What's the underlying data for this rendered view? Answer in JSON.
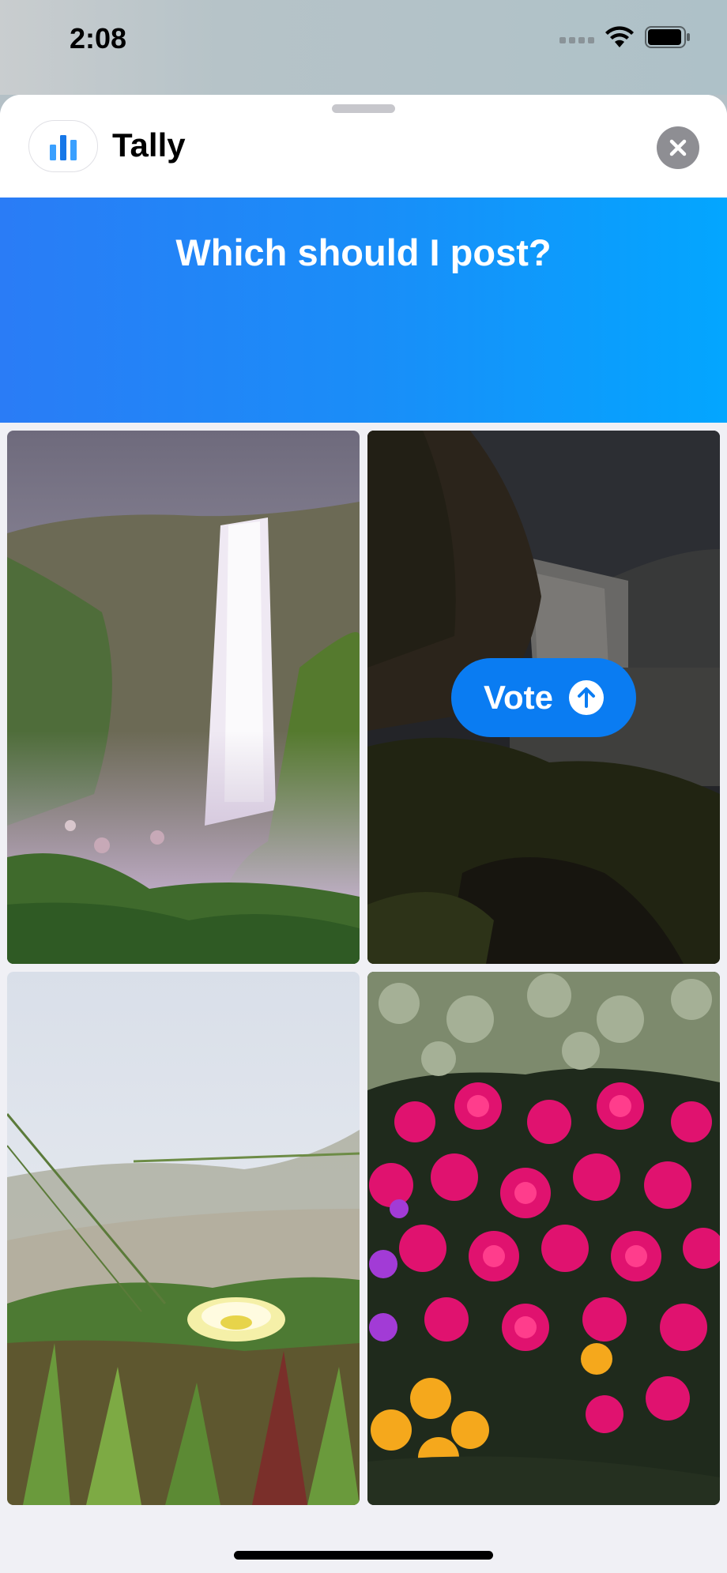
{
  "status_bar": {
    "time": "2:08"
  },
  "header": {
    "app_name": "Tally"
  },
  "poll": {
    "question": "Which should I post?"
  },
  "vote_button": {
    "label": "Vote"
  },
  "tiles": [
    {
      "name": "waterfall-photo"
    },
    {
      "name": "dark-waterfall-photo"
    },
    {
      "name": "yellow-flower-photo"
    },
    {
      "name": "pink-flowers-photo"
    }
  ],
  "colors": {
    "accent": "#0a7cf2",
    "banner_start": "#2a7cf6",
    "banner_end": "#03a6ff"
  }
}
